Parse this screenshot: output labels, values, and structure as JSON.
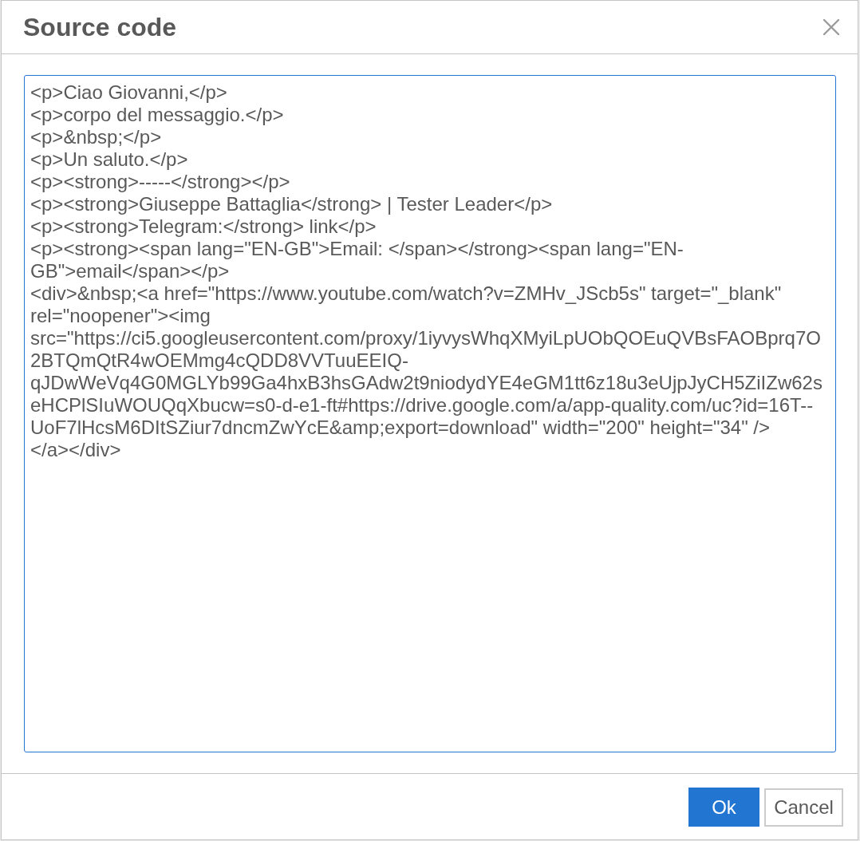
{
  "dialog": {
    "title": "Source code"
  },
  "source_code": {
    "lines": [
      "<p>Ciao Giovanni,</p>",
      "<p>corpo del messaggio.</p>",
      "<p>&nbsp;</p>",
      "<p>Un saluto.</p>",
      "<p><strong>-----</strong></p>",
      "<p><strong>Giuseppe Battaglia</strong> | Tester Leader</p>",
      "<p><strong>Telegram:</strong> link</p>",
      "<p><strong><span lang=\"EN-GB\">Email: </span></strong><span lang=\"EN-GB\">email</span></p>",
      "<div>&nbsp;<a href=\"https://www.youtube.com/watch?v=ZMHv_JScb5s\" target=\"_blank\" rel=\"noopener\"><img src=\"https://ci5.googleusercontent.com/proxy/1iyvysWhqXMyiLpUObQOEuQVBsFAOBprq7O2BTQmQtR4wOEMmg4cQDD8VVTuuEEIQ-qJDwWeVq4G0MGLYb99Ga4hxB3hsGAdw2t9niodydYE4eGM1tt6z18u3eUjpJyCH5ZiIZw62seHCPlSIuWOUQqXbucw=s0-d-e1-ft#https://drive.google.com/a/app-quality.com/uc?id=16T--UoF7lHcsM6DItSZiur7dncmZwYcE&amp;export=download\" width=\"200\" height=\"34\" />",
      "</a></div>"
    ]
  },
  "buttons": [
    {
      "label": "Ok",
      "kind": "primary"
    },
    {
      "label": "Cancel",
      "kind": "secondary"
    }
  ]
}
